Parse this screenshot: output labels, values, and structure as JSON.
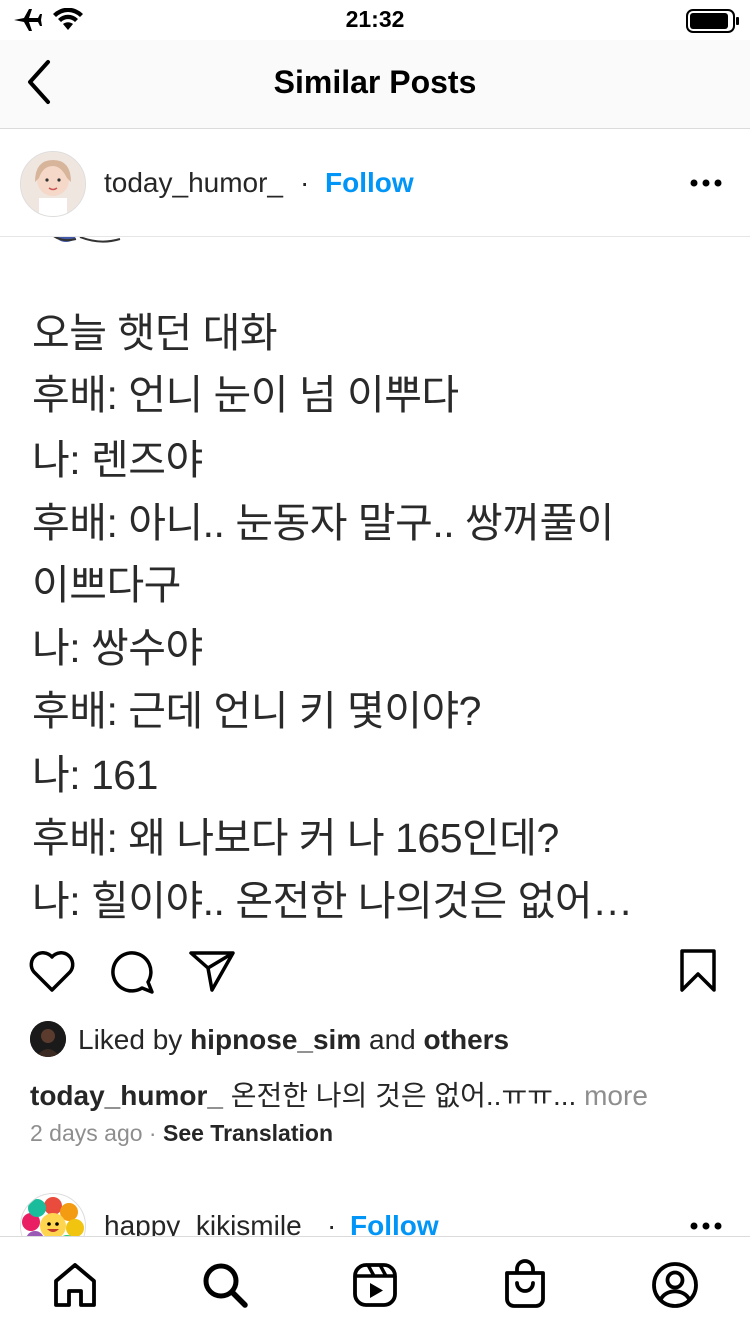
{
  "status_bar": {
    "time": "21:32",
    "icons": [
      "airplane-icon",
      "wifi-icon",
      "battery-icon"
    ]
  },
  "nav": {
    "title": "Similar Posts",
    "back_icon": "chevron-left-icon"
  },
  "post1": {
    "username": "today_humor_",
    "dot": "·",
    "follow_label": "Follow",
    "more_icon": "more-horizontal-icon",
    "image_text_lines": [
      "오늘 햇던 대화",
      "후배: 언니 눈이 넘 이뿌다",
      "나: 렌즈야",
      "후배: 아니.. 눈동자 말구.. 쌍꺼풀이",
      "이쁘다구",
      "나: 쌍수야",
      "후배: 근데 언니 키 몇이야?",
      "나: 161",
      "후배: 왜 나보다 커 나 165인데?",
      "나: 힐이야.. 온전한 나의것은 없어…"
    ],
    "liked_by_prefix": "Liked by",
    "liked_by_user": "hipnose_sim",
    "liked_by_and": "and",
    "liked_by_others": "others",
    "caption_username": "today_humor_",
    "caption_text": "온전한 나의 것은 없어..ㅠㅠ...",
    "caption_more": "more",
    "time_ago": "2 days ago",
    "time_sep": "·",
    "see_translation": "See Translation"
  },
  "post2": {
    "username": "happy_kikismile",
    "dot": "·",
    "follow_label": "Follow"
  },
  "tab_bar": {
    "items": [
      "home-icon",
      "search-icon",
      "reels-icon",
      "shop-icon",
      "profile-icon"
    ]
  },
  "colors": {
    "accent": "#0095f6",
    "text": "#262626",
    "muted": "#8e8e8e",
    "divider": "#dbdbdb"
  }
}
